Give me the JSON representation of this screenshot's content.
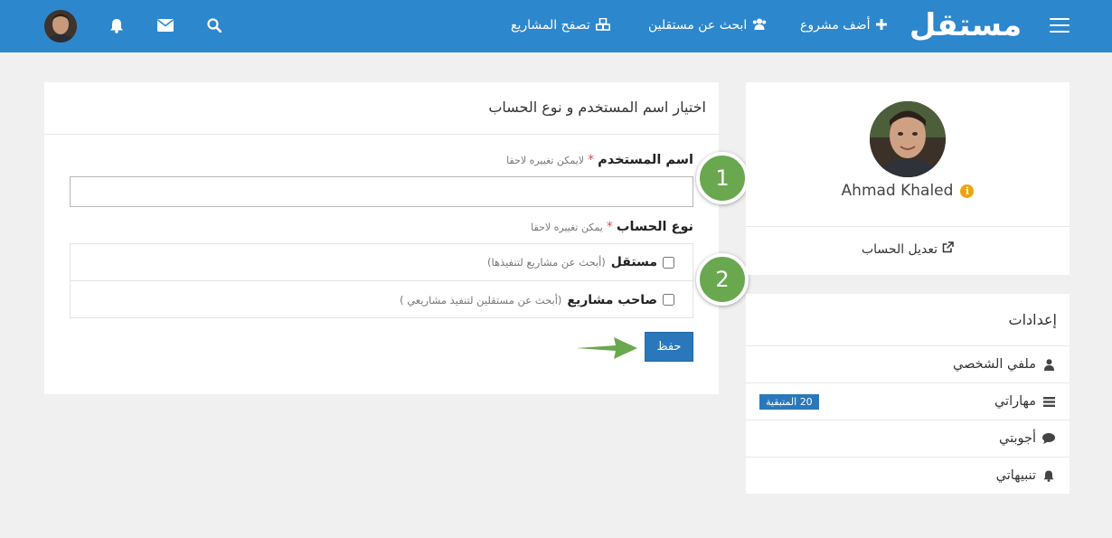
{
  "brand": {
    "logo_text": "مستقل",
    "primary_color": "#2d87cd",
    "success_color": "#6aa84f"
  },
  "nav": {
    "add_project": "أضف مشروع",
    "find_freelancers": "ابحث عن مستقلين",
    "browse_projects": "تصفح المشاريع",
    "icons": [
      "menu-icon",
      "plus-icon",
      "users-icon",
      "cubes-icon",
      "search-icon",
      "envelope-icon",
      "bell-icon"
    ]
  },
  "form": {
    "title": "اختيار اسم المستخدم و نوع الحساب",
    "username_label": "اسم المستخدم",
    "username_required": "*",
    "username_hint": "لايمكن تغييره لاحقا",
    "username_value": "",
    "account_type_label": "نوع الحساب",
    "account_type_required": "*",
    "account_type_hint": "يمكن تغييره لاحقا",
    "options": [
      {
        "label": "مستقل",
        "hint": "(أبحث عن مشاريع لتنفيذها)"
      },
      {
        "label": "صاحب مشاريع",
        "hint": "(أبحث عن مستقلين لتنفيذ مشاريعي )"
      }
    ],
    "save_label": "حفظ"
  },
  "steps": {
    "one": "1",
    "two": "2"
  },
  "profile": {
    "name": "Ahmad Khaled",
    "edit_account": "تعديل الحساب"
  },
  "settings": {
    "title": "إعدادات",
    "items": [
      {
        "label": "ملفي الشخصي",
        "icon": "user-icon"
      },
      {
        "label": "مهاراتي",
        "icon": "list-icon",
        "badge": "20 المتبقية"
      },
      {
        "label": "أجوبتي",
        "icon": "comment-icon"
      },
      {
        "label": "تنبيهاتي",
        "icon": "bell-icon"
      }
    ]
  }
}
